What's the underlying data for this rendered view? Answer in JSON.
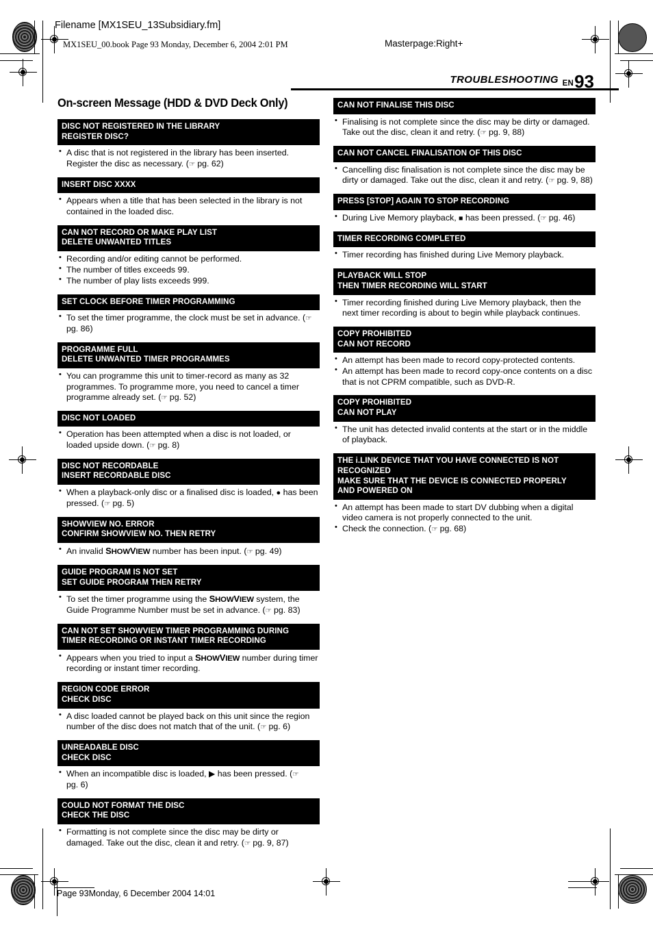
{
  "slug": {
    "filename": "Filename [MX1SEU_13Subsidiary.fm]",
    "book_line": "MX1SEU_00.book  Page 93  Monday, December 6, 2004  2:01 PM",
    "masterpage": "Masterpage:Right+",
    "footer": "Page 93Monday, 6 December 2004  14:01"
  },
  "running_head": {
    "title": "TROUBLESHOOTING",
    "lang": "EN",
    "page_number": "93"
  },
  "section": {
    "title": "On-screen Message (HDD & DVD Deck Only)"
  },
  "columns": {
    "left": [
      {
        "head": [
          "DISC NOT REGISTERED IN THE LIBRARY",
          "REGISTER DISC?"
        ],
        "bullets": [
          "A disc that is not registered in the library has been inserted. Register the disc as necessary. (☞ pg. 62)"
        ]
      },
      {
        "head": [
          "INSERT DISC XXXX"
        ],
        "bullets": [
          "Appears when a title that has been selected in the library is not contained in the loaded disc."
        ]
      },
      {
        "head": [
          "CAN NOT RECORD OR MAKE PLAY LIST",
          "DELETE UNWANTED TITLES"
        ],
        "bullets": [
          "Recording and/or editing cannot be performed.",
          "The number of titles exceeds 99.",
          "The number of play lists exceeds 999."
        ]
      },
      {
        "head": [
          "SET CLOCK BEFORE TIMER PROGRAMMING"
        ],
        "bullets": [
          "To set the timer programme, the clock must be set in advance. (☞ pg. 86)"
        ]
      },
      {
        "head": [
          "PROGRAMME FULL",
          "DELETE UNWANTED TIMER PROGRAMMES"
        ],
        "bullets": [
          "You can programme this unit to timer-record as many as 32 programmes. To programme more, you need to cancel a timer programme already set. (☞ pg. 52)"
        ]
      },
      {
        "head": [
          "DISC NOT LOADED"
        ],
        "bullets": [
          "Operation has been attempted when a disc is not loaded, or loaded upside down. (☞ pg. 8)"
        ]
      },
      {
        "head": [
          "DISC NOT RECORDABLE",
          "INSERT RECORDABLE DISC"
        ],
        "bullets": [
          "When a playback-only disc or a finalised disc is loaded, ● has been pressed. (☞ pg. 5)"
        ]
      },
      {
        "head": [
          "SHOWVIEW NO. ERROR",
          "CONFIRM SHOWVIEW NO. THEN RETRY"
        ],
        "bullets": [
          "An invalid SHOWVIEW number has been input. (☞ pg. 49)"
        ]
      },
      {
        "head": [
          "GUIDE PROGRAM IS NOT SET",
          "SET GUIDE PROGRAM THEN RETRY"
        ],
        "bullets": [
          "To set the timer programme using the SHOWVIEW system, the Guide Programme Number must be set in advance. (☞ pg. 83)"
        ]
      },
      {
        "head": [
          "CAN NOT SET SHOWVIEW TIMER PROGRAMMING DURING",
          "TIMER RECORDING OR INSTANT TIMER RECORDING"
        ],
        "bullets": [
          "Appears when you tried to input a SHOWVIEW number during timer recording or instant timer recording."
        ]
      },
      {
        "head": [
          "REGION CODE ERROR",
          "CHECK DISC"
        ],
        "bullets": [
          "A disc loaded cannot be played back on this unit since the region number of the disc does not match that of the unit. (☞ pg. 6)"
        ]
      },
      {
        "head": [
          "UNREADABLE DISC",
          "CHECK DISC"
        ],
        "bullets": [
          "When an incompatible disc is loaded, ▶ has been pressed. (☞ pg. 6)"
        ]
      },
      {
        "head": [
          "COULD NOT FORMAT THE DISC",
          "CHECK THE DISC"
        ],
        "bullets": [
          "Formatting is not complete since the disc may be dirty or damaged. Take out the disc, clean it and retry. (☞ pg. 9, 87)"
        ]
      }
    ],
    "right": [
      {
        "head": [
          "CAN NOT FINALISE THIS DISC"
        ],
        "bullets": [
          "Finalising is not complete since the disc may be dirty or damaged. Take out the disc, clean it and retry. (☞ pg. 9, 88)"
        ]
      },
      {
        "head": [
          "CAN NOT CANCEL FINALISATION OF THIS DISC"
        ],
        "bullets": [
          "Cancelling disc finalisation is not complete since the disc may be dirty or damaged. Take out the disc, clean it and retry. (☞ pg. 9, 88)"
        ]
      },
      {
        "head": [
          "PRESS [STOP] AGAIN TO STOP RECORDING"
        ],
        "bullets": [
          "During Live Memory playback, ■ has been pressed. (☞ pg. 46)"
        ]
      },
      {
        "head": [
          "TIMER RECORDING COMPLETED"
        ],
        "bullets": [
          "Timer recording has finished during Live Memory playback."
        ]
      },
      {
        "head": [
          "PLAYBACK WILL STOP",
          "THEN TIMER RECORDING WILL START"
        ],
        "bullets": [
          "Timer recording finished during Live Memory playback, then the next timer recording is about to begin while playback continues."
        ]
      },
      {
        "head": [
          "COPY PROHIBITED",
          "CAN NOT RECORD"
        ],
        "bullets": [
          "An attempt has been made to record copy-protected contents.",
          "An attempt has been made to record copy-once contents on a disc that is not CPRM compatible, such as DVD-R."
        ]
      },
      {
        "head": [
          "COPY PROHIBITED",
          "CAN NOT PLAY"
        ],
        "bullets": [
          "The unit has detected invalid contents at the start or in the middle of playback."
        ]
      },
      {
        "head": [
          "THE i.LINK DEVICE THAT YOU HAVE CONNECTED IS NOT",
          "RECOGNIZED",
          "MAKE SURE THAT THE DEVICE IS CONNECTED PROPERLY",
          "AND POWERED ON"
        ],
        "bullets": [
          "An attempt has been made to start DV dubbing when a digital video camera is not properly connected to the unit.",
          "Check the connection. (☞ pg. 68)"
        ]
      }
    ]
  },
  "colors": {
    "header_bg": "#000000",
    "header_text": "#ffffff",
    "page_bg": "#ffffff",
    "body_text": "#000000"
  }
}
